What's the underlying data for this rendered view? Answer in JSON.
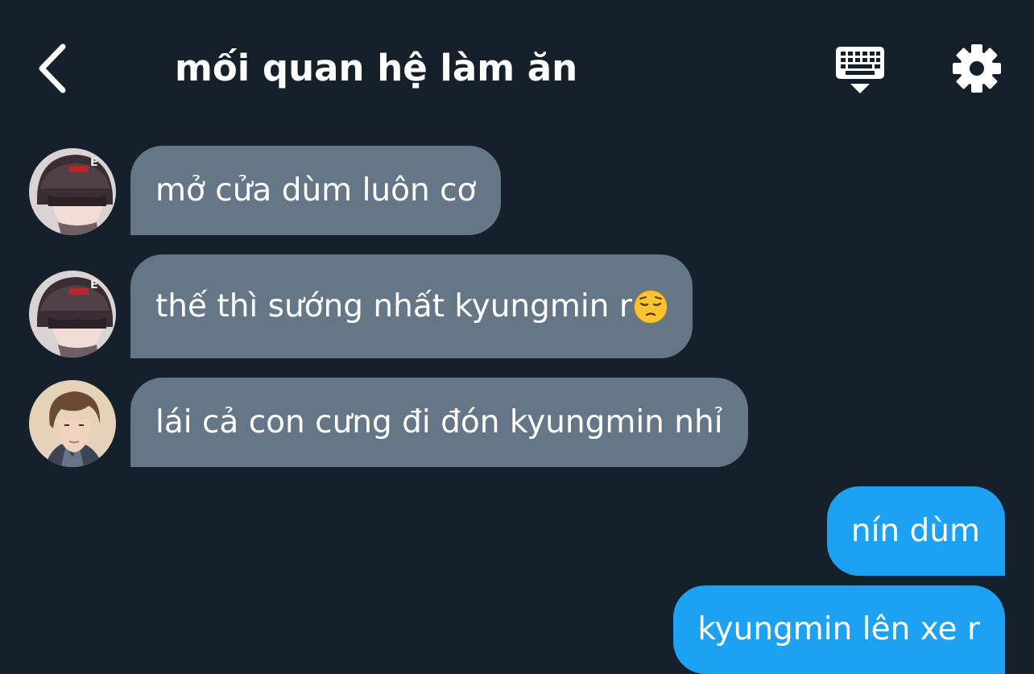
{
  "header": {
    "title": "mối quan hệ làm ăn",
    "back_icon": "chevron-left-icon",
    "keyboard_icon": "keyboard-hide-icon",
    "settings_icon": "gear-icon"
  },
  "colors": {
    "background": "#15202b",
    "incoming_bubble": "#657786",
    "outgoing_bubble": "#1da1f2",
    "text": "#ffffff"
  },
  "messages": [
    {
      "direction": "incoming",
      "sender_avatar": "avatar-beanie",
      "text": "mở cửa dùm luôn cơ"
    },
    {
      "direction": "incoming",
      "sender_avatar": "avatar-beanie",
      "text": "thế thì sướng nhất kyungmin r",
      "emoji": "pensive-face"
    },
    {
      "direction": "incoming",
      "sender_avatar": "avatar-brown-hair",
      "text": "lái cả con cưng đi đón kyungmin nhỉ"
    },
    {
      "direction": "outgoing",
      "text": "nín dùm"
    },
    {
      "direction": "outgoing",
      "text": "kyungmin lên xe r"
    }
  ]
}
